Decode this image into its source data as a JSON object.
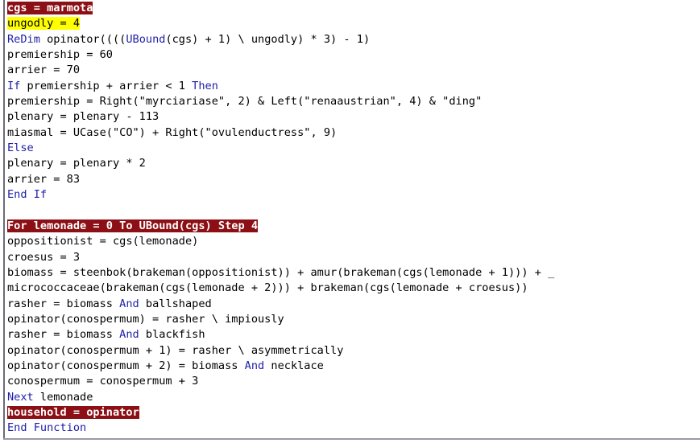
{
  "editor": {
    "name": "vba-code-editor",
    "language": "VBA",
    "background_color": "#ffffff",
    "text_color": "#000000",
    "keyword_color": "#1f1fa8",
    "selection_background": "#8b0f14",
    "selection_text_color": "#ffffff",
    "find_highlight_background": "#ffff00",
    "caret_color": "#1f4fd8"
  },
  "code_lines": [
    {
      "index": 0,
      "highlight": "selection",
      "caret": false,
      "tokens": [
        {
          "t": "cgs = marmota",
          "k": false
        }
      ]
    },
    {
      "index": 1,
      "highlight": "find",
      "caret": true,
      "tokens": [
        {
          "t": "ungodly = 4",
          "k": false
        }
      ]
    },
    {
      "index": 2,
      "highlight": "none",
      "caret": false,
      "tokens": [
        {
          "t": "ReDim",
          "k": true
        },
        {
          "t": " opinator((((",
          "k": false
        },
        {
          "t": "UBound",
          "k": true
        },
        {
          "t": "(cgs) + 1) \\ ungodly) * 3) - 1)",
          "k": false
        }
      ]
    },
    {
      "index": 3,
      "highlight": "none",
      "caret": false,
      "tokens": [
        {
          "t": "premiership = 60",
          "k": false
        }
      ]
    },
    {
      "index": 4,
      "highlight": "none",
      "caret": false,
      "tokens": [
        {
          "t": "arrier = 70",
          "k": false
        }
      ]
    },
    {
      "index": 5,
      "highlight": "none",
      "caret": false,
      "tokens": [
        {
          "t": "If",
          "k": true
        },
        {
          "t": " premiership + arrier < 1 ",
          "k": false
        },
        {
          "t": "Then",
          "k": true
        }
      ]
    },
    {
      "index": 6,
      "highlight": "none",
      "caret": false,
      "tokens": [
        {
          "t": "premiership = Right(\"myrciariase\", 2) & Left(\"renaaustrian\", 4) & \"ding\"",
          "k": false
        }
      ]
    },
    {
      "index": 7,
      "highlight": "none",
      "caret": false,
      "tokens": [
        {
          "t": "plenary = plenary - 113",
          "k": false
        }
      ]
    },
    {
      "index": 8,
      "highlight": "none",
      "caret": false,
      "tokens": [
        {
          "t": "miasmal = UCase(\"CO\") + Right(\"ovulenductress\", 9)",
          "k": false
        }
      ]
    },
    {
      "index": 9,
      "highlight": "none",
      "caret": false,
      "tokens": [
        {
          "t": "Else",
          "k": true
        }
      ]
    },
    {
      "index": 10,
      "highlight": "none",
      "caret": false,
      "tokens": [
        {
          "t": "plenary = plenary * 2",
          "k": false
        }
      ]
    },
    {
      "index": 11,
      "highlight": "none",
      "caret": false,
      "tokens": [
        {
          "t": "arrier = 83",
          "k": false
        }
      ]
    },
    {
      "index": 12,
      "highlight": "none",
      "caret": false,
      "tokens": [
        {
          "t": "End If",
          "k": true
        }
      ]
    },
    {
      "index": 13,
      "highlight": "none",
      "caret": false,
      "tokens": [
        {
          "t": "",
          "k": false
        }
      ]
    },
    {
      "index": 14,
      "highlight": "selection",
      "caret": false,
      "tokens": [
        {
          "t": "For lemonade = 0 To UBound(cgs) Step 4",
          "k": false
        }
      ]
    },
    {
      "index": 15,
      "highlight": "none",
      "caret": false,
      "tokens": [
        {
          "t": "oppositionist = cgs(lemonade)",
          "k": false
        }
      ]
    },
    {
      "index": 16,
      "highlight": "none",
      "caret": false,
      "tokens": [
        {
          "t": "croesus = 3",
          "k": false
        }
      ]
    },
    {
      "index": 17,
      "highlight": "none",
      "caret": false,
      "tokens": [
        {
          "t": "biomass = steenbok(brakeman(oppositionist)) + amur(brakeman(cgs(lemonade + 1))) + _",
          "k": false
        }
      ]
    },
    {
      "index": 18,
      "highlight": "none",
      "caret": false,
      "tokens": [
        {
          "t": "micrococcaceae(brakeman(cgs(lemonade + 2))) + brakeman(cgs(lemonade + croesus))",
          "k": false
        }
      ]
    },
    {
      "index": 19,
      "highlight": "none",
      "caret": false,
      "tokens": [
        {
          "t": "rasher = biomass ",
          "k": false
        },
        {
          "t": "And",
          "k": true
        },
        {
          "t": " ballshaped",
          "k": false
        }
      ]
    },
    {
      "index": 20,
      "highlight": "none",
      "caret": false,
      "tokens": [
        {
          "t": "opinator(conospermum) = rasher \\ impiously",
          "k": false
        }
      ]
    },
    {
      "index": 21,
      "highlight": "none",
      "caret": false,
      "tokens": [
        {
          "t": "rasher = biomass ",
          "k": false
        },
        {
          "t": "And",
          "k": true
        },
        {
          "t": " blackfish",
          "k": false
        }
      ]
    },
    {
      "index": 22,
      "highlight": "none",
      "caret": false,
      "tokens": [
        {
          "t": "opinator(conospermum + 1) = rasher \\ asymmetrically",
          "k": false
        }
      ]
    },
    {
      "index": 23,
      "highlight": "none",
      "caret": false,
      "tokens": [
        {
          "t": "opinator(conospermum + 2) = biomass ",
          "k": false
        },
        {
          "t": "And",
          "k": true
        },
        {
          "t": " necklace",
          "k": false
        }
      ]
    },
    {
      "index": 24,
      "highlight": "none",
      "caret": false,
      "tokens": [
        {
          "t": "conospermum = conospermum + 3",
          "k": false
        }
      ]
    },
    {
      "index": 25,
      "highlight": "none",
      "caret": false,
      "tokens": [
        {
          "t": "Next",
          "k": true
        },
        {
          "t": " lemonade",
          "k": false
        }
      ]
    },
    {
      "index": 26,
      "highlight": "selection",
      "caret": false,
      "tokens": [
        {
          "t": "household = opinator",
          "k": false
        }
      ]
    },
    {
      "index": 27,
      "highlight": "none",
      "caret": false,
      "tokens": [
        {
          "t": "End Function",
          "k": true
        }
      ]
    }
  ]
}
